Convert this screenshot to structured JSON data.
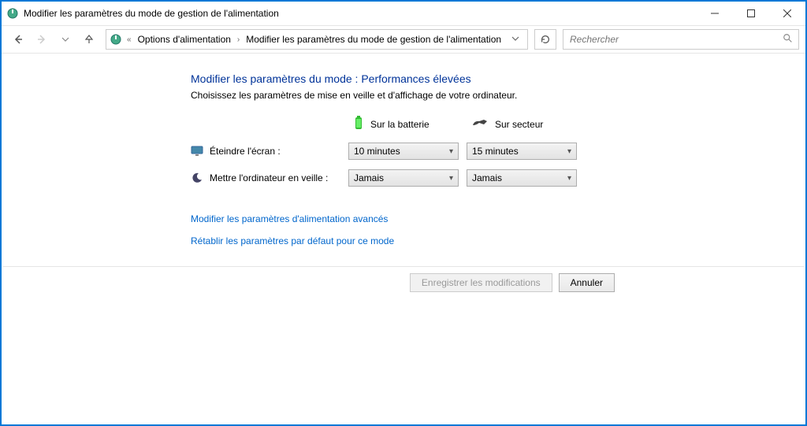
{
  "window": {
    "title": "Modifier les paramètres du mode de gestion de l'alimentation"
  },
  "breadcrumb": {
    "prefix": "«",
    "items": [
      "Options d'alimentation",
      "Modifier les paramètres du mode de gestion de l'alimentation"
    ]
  },
  "search": {
    "placeholder": "Rechercher"
  },
  "main": {
    "heading": "Modifier les paramètres du mode : Performances élevées",
    "subheading": "Choisissez les paramètres de mise en veille et d'affichage de votre ordinateur.",
    "columns": {
      "battery": "Sur la batterie",
      "ac": "Sur secteur"
    },
    "rows": [
      {
        "label": "Éteindre l'écran :",
        "battery_value": "10 minutes",
        "ac_value": "15 minutes"
      },
      {
        "label": "Mettre l'ordinateur en veille :",
        "battery_value": "Jamais",
        "ac_value": "Jamais"
      }
    ],
    "links": {
      "advanced": "Modifier les paramètres d'alimentation avancés",
      "restore": "Rétablir les paramètres par défaut pour ce mode"
    }
  },
  "footer": {
    "save": "Enregistrer les modifications",
    "cancel": "Annuler"
  }
}
